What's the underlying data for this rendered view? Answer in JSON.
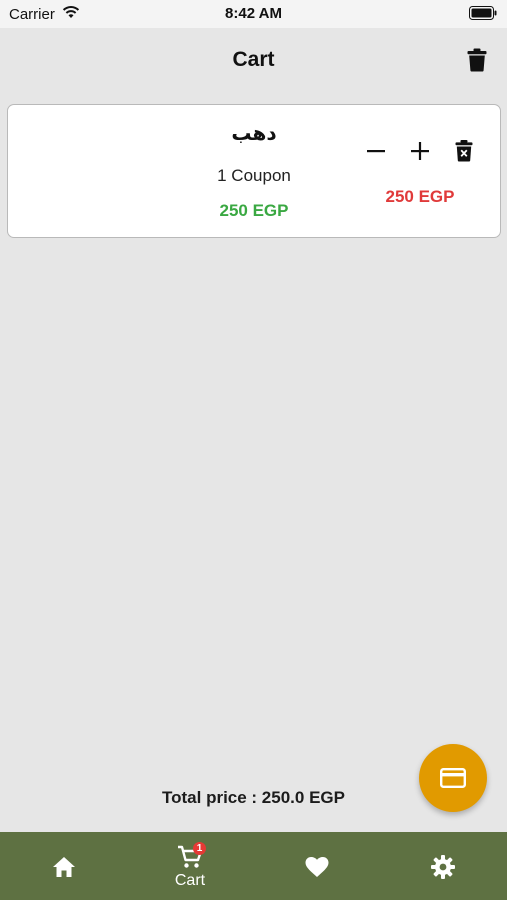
{
  "status_bar": {
    "carrier": "Carrier",
    "time": "8:42 AM"
  },
  "header": {
    "title": "Cart",
    "clear_icon": "trash-icon"
  },
  "cart": {
    "items": [
      {
        "name": "دهب",
        "quantity_label": "1 Coupon",
        "unit_price": "250 EGP",
        "total_price": "250 EGP"
      }
    ],
    "total_label": "Total price : 250.0 EGP"
  },
  "fab": {
    "icon": "credit-card-icon"
  },
  "bottom_nav": {
    "items": [
      {
        "icon": "home-icon",
        "label": ""
      },
      {
        "icon": "cart-icon",
        "label": "Cart",
        "badge": "1"
      },
      {
        "icon": "heart-icon",
        "label": ""
      },
      {
        "icon": "gear-icon",
        "label": ""
      }
    ]
  },
  "colors": {
    "background": "#e6e6e6",
    "unit_price": "#3aa842",
    "total_price": "#e03a3a",
    "fab": "#e19a00",
    "nav": "#5e7142"
  }
}
